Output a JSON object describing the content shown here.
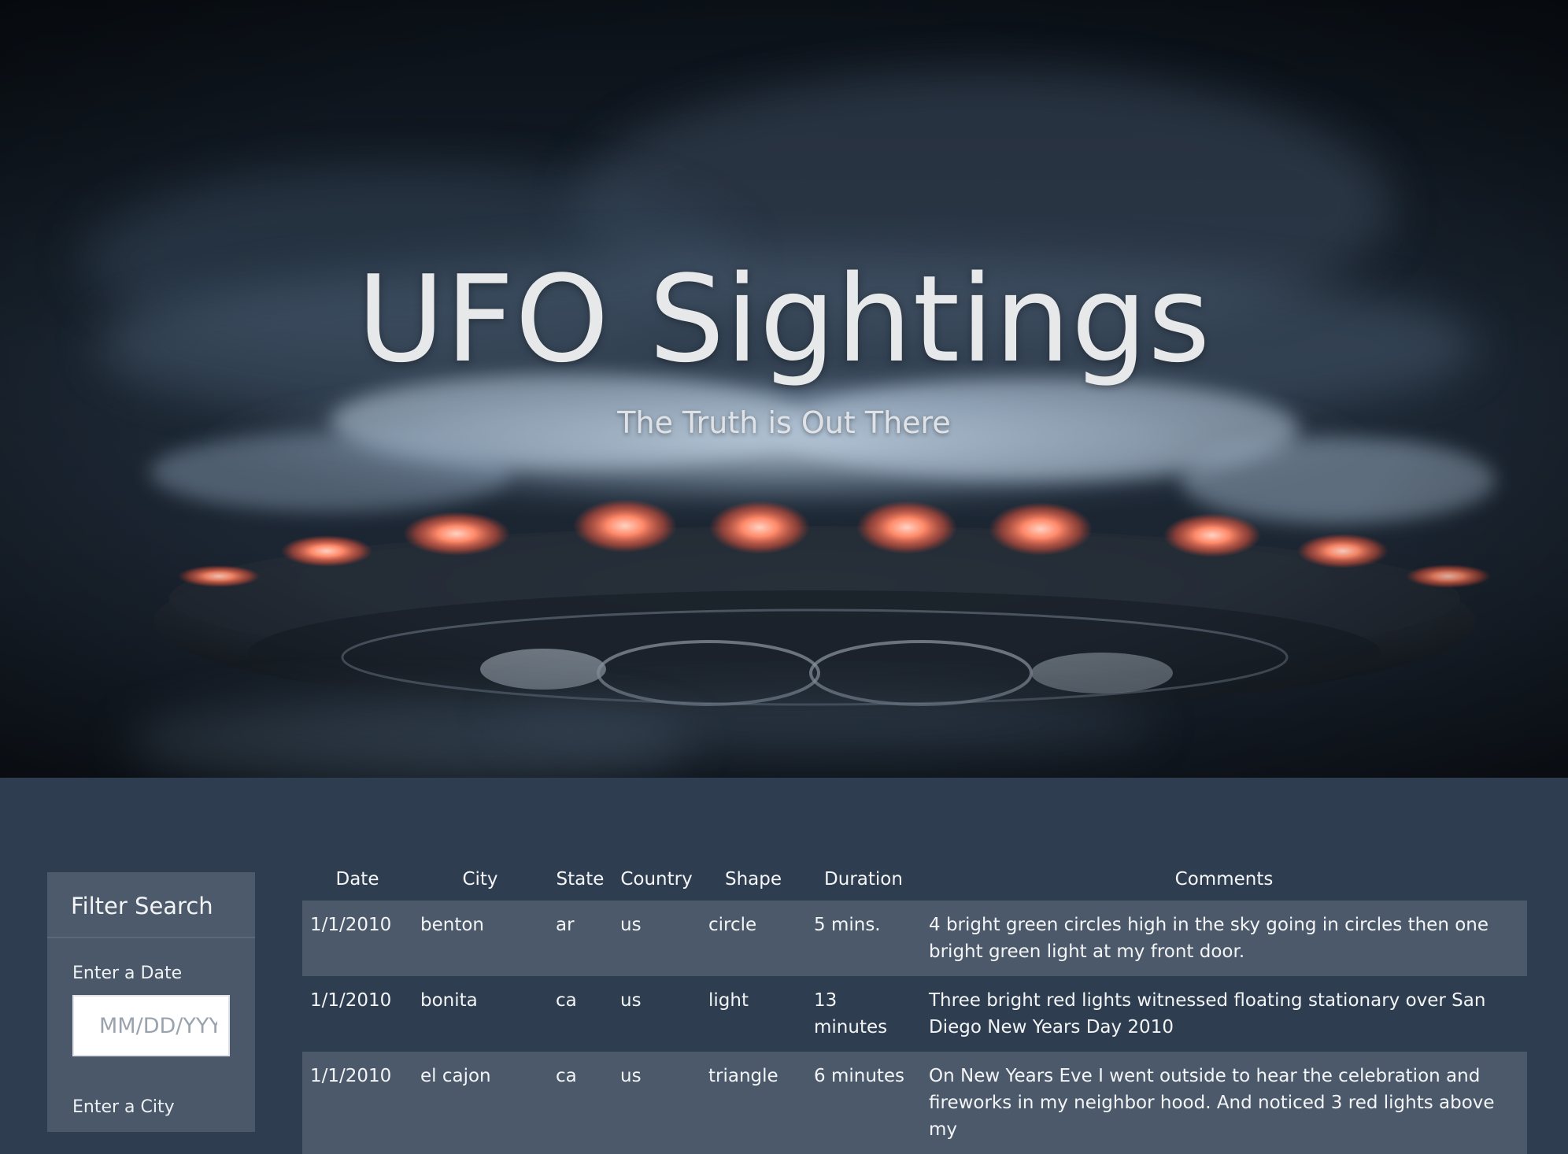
{
  "hero": {
    "title": "UFO Sightings",
    "subtitle": "The Truth is Out There"
  },
  "filter": {
    "heading": "Filter Search",
    "date_label": "Enter a Date",
    "date_placeholder": "MM/DD/YYYY",
    "city_label": "Enter a City"
  },
  "table": {
    "columns": [
      "Date",
      "City",
      "State",
      "Country",
      "Shape",
      "Duration",
      "Comments"
    ],
    "rows": [
      {
        "date": "1/1/2010",
        "city": "benton",
        "state": "ar",
        "country": "us",
        "shape": "circle",
        "duration": "5 mins.",
        "comments": "4 bright green circles high in the sky going in circles then one bright green light at my front door."
      },
      {
        "date": "1/1/2010",
        "city": "bonita",
        "state": "ca",
        "country": "us",
        "shape": "light",
        "duration": "13 minutes",
        "comments": "Three bright red lights witnessed floating stationary over San Diego New Years Day 2010"
      },
      {
        "date": "1/1/2010",
        "city": "el cajon",
        "state": "ca",
        "country": "us",
        "shape": "triangle",
        "duration": "6 minutes",
        "comments": "On New Years Eve I went outside to hear the celebration and fireworks in my neighbor hood. And noticed 3 red lights above my"
      }
    ]
  },
  "colors": {
    "page_background": "#2e3e50",
    "panel_background": "#4b5869",
    "striped_row": "#4c596a",
    "saucer_light": "#ff7a5c"
  }
}
